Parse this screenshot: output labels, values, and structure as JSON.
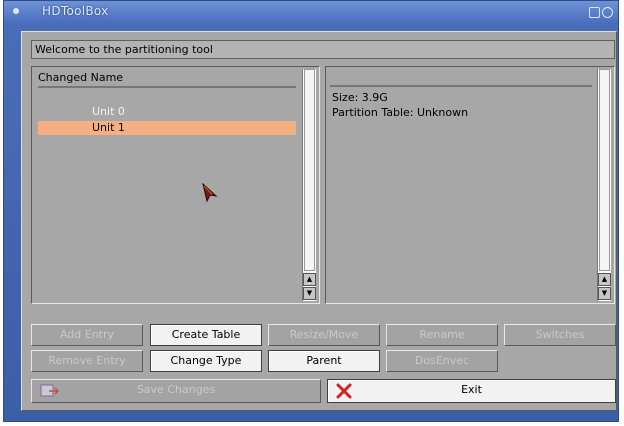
{
  "window": {
    "title": "HDToolBox"
  },
  "welcome_text": "Welcome to the partitioning tool",
  "list": {
    "header": "Changed Name",
    "items": [
      {
        "label": "Unit 0",
        "selected": false
      },
      {
        "label": "Unit 1",
        "selected": true
      }
    ]
  },
  "info": {
    "size": "Size: 3.9G",
    "partition_table": "Partition Table: Unknown"
  },
  "buttons": {
    "add_entry": "Add Entry",
    "create_table": "Create Table",
    "resize_move": "Resize/Move",
    "rename": "Rename",
    "switches": "Switches",
    "remove_entry": "Remove Entry",
    "change_type": "Change Type",
    "parent": "Parent",
    "dosenvec": "DosEnvec",
    "save_changes": "Save Changes",
    "exit": "Exit"
  },
  "icons": {
    "save": "save-changes-icon",
    "exit": "red-x-icon"
  },
  "colors": {
    "window_blue": "#4a6fb8",
    "panel_gray": "#a7a7a7",
    "selection": "#f4b083",
    "exit_x": "#d42020"
  }
}
